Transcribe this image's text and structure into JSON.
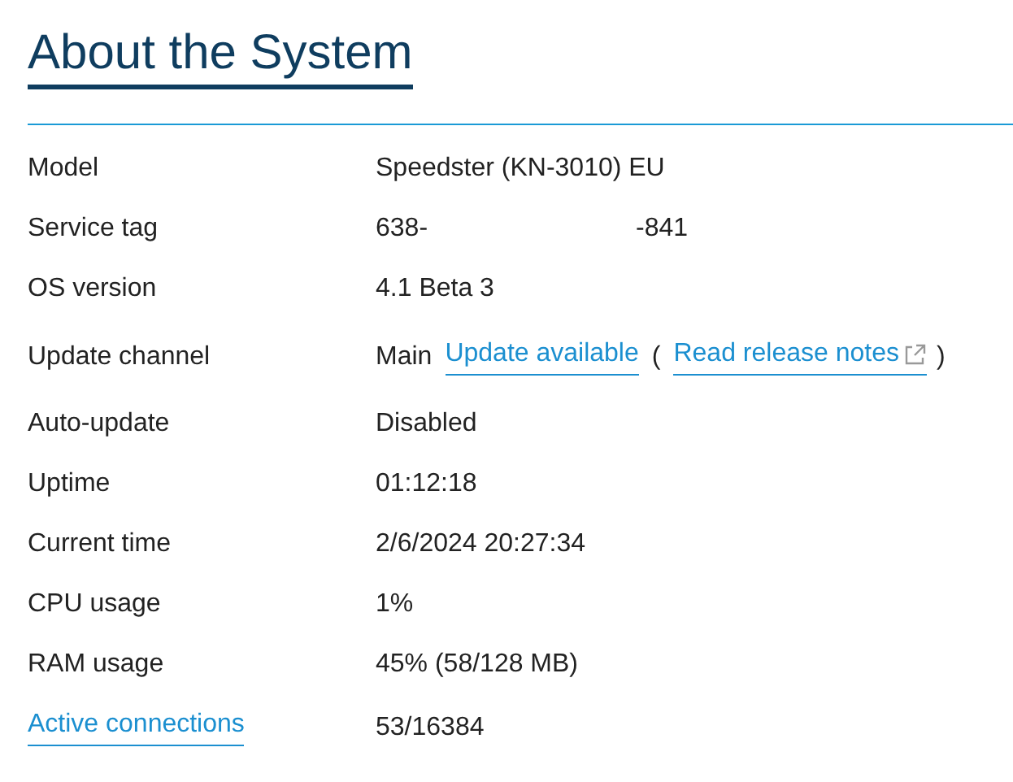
{
  "title": "About the System",
  "rows": [
    {
      "label": {
        "kind": "text",
        "text": "Model"
      },
      "value": [
        {
          "kind": "text",
          "text": "Speedster (KN-3010) EU"
        }
      ]
    },
    {
      "label": {
        "kind": "text",
        "text": "Service tag"
      },
      "value": [
        {
          "kind": "text",
          "text": "638-"
        },
        {
          "kind": "redacted"
        },
        {
          "kind": "text",
          "text": "-841"
        }
      ]
    },
    {
      "label": {
        "kind": "text",
        "text": "OS version"
      },
      "value": [
        {
          "kind": "text",
          "text": "4.1 Beta 3"
        }
      ]
    },
    {
      "label": {
        "kind": "text",
        "text": "Update channel"
      },
      "value": [
        {
          "kind": "text",
          "text": "Main"
        },
        {
          "kind": "link",
          "text": "Update available"
        },
        {
          "kind": "text",
          "text": "("
        },
        {
          "kind": "external_link",
          "text": "Read release notes"
        },
        {
          "kind": "text",
          "text": ")"
        }
      ]
    },
    {
      "label": {
        "kind": "text",
        "text": "Auto-update"
      },
      "value": [
        {
          "kind": "text",
          "text": "Disabled"
        }
      ]
    },
    {
      "label": {
        "kind": "text",
        "text": "Uptime"
      },
      "value": [
        {
          "kind": "text",
          "text": "01:12:18"
        }
      ]
    },
    {
      "label": {
        "kind": "text",
        "text": "Current time"
      },
      "value": [
        {
          "kind": "text",
          "text": "2/6/2024 20:27:34"
        }
      ]
    },
    {
      "label": {
        "kind": "text",
        "text": "CPU usage"
      },
      "value": [
        {
          "kind": "text",
          "text": "1%"
        }
      ]
    },
    {
      "label": {
        "kind": "text",
        "text": "RAM usage"
      },
      "value": [
        {
          "kind": "text",
          "text": "45% (58/128 MB)"
        }
      ]
    },
    {
      "label": {
        "kind": "link",
        "text": "Active connections"
      },
      "value": [
        {
          "kind": "text",
          "text": "53/16384"
        }
      ]
    }
  ]
}
